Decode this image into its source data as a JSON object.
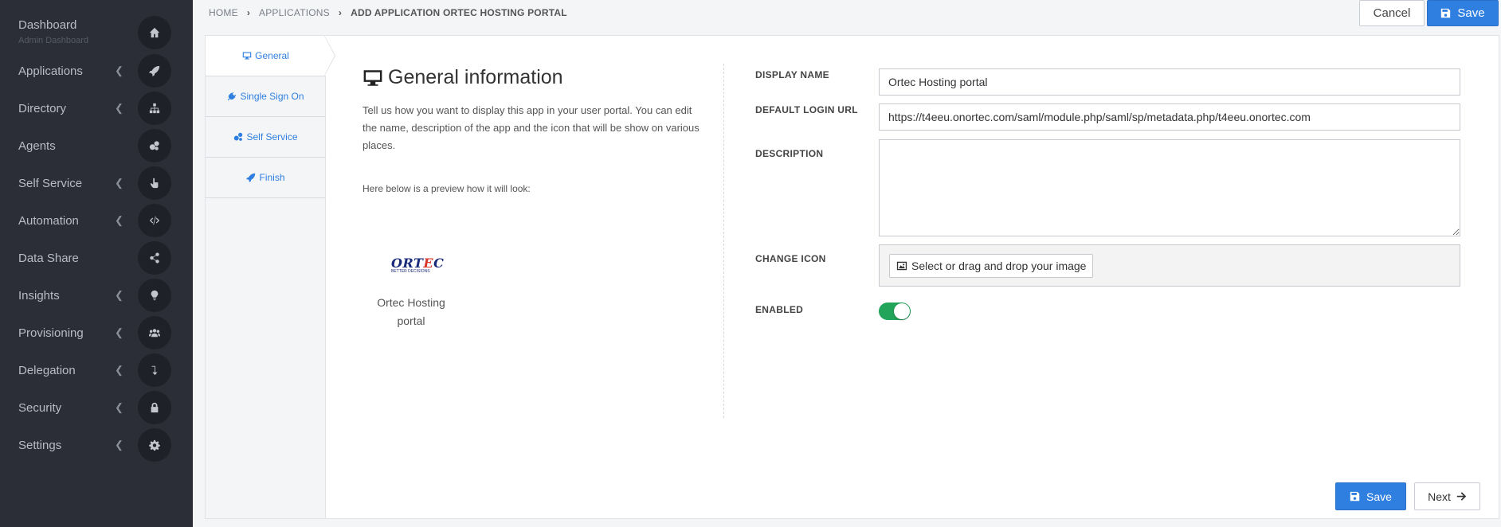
{
  "sidebar": {
    "items": [
      {
        "label": "Dashboard",
        "sublabel": "Admin Dashboard",
        "icon": "home-icon",
        "chevron": false
      },
      {
        "label": "Applications",
        "icon": "rocket-icon",
        "chevron": true
      },
      {
        "label": "Directory",
        "icon": "sitemap-icon",
        "chevron": true
      },
      {
        "label": "Agents",
        "icon": "cogs-icon",
        "chevron": false
      },
      {
        "label": "Self Service",
        "icon": "hand-pointer-icon",
        "chevron": true
      },
      {
        "label": "Automation",
        "icon": "code-icon",
        "chevron": true
      },
      {
        "label": "Data Share",
        "icon": "share-icon",
        "chevron": false
      },
      {
        "label": "Insights",
        "icon": "lightbulb-icon",
        "chevron": true
      },
      {
        "label": "Provisioning",
        "icon": "users-icon",
        "chevron": true
      },
      {
        "label": "Delegation",
        "icon": "level-down-icon",
        "chevron": true
      },
      {
        "label": "Security",
        "icon": "lock-icon",
        "chevron": true
      },
      {
        "label": "Settings",
        "icon": "gear-icon",
        "chevron": true
      }
    ]
  },
  "breadcrumb": {
    "home": "HOME",
    "applications": "APPLICATIONS",
    "current": "ADD APPLICATION ORTEC HOSTING PORTAL"
  },
  "toolbar": {
    "cancel_label": "Cancel",
    "save_label": "Save"
  },
  "tabs": [
    {
      "label": "General",
      "icon": "desktop-icon",
      "active": true
    },
    {
      "label": "Single Sign On",
      "icon": "plug-icon",
      "active": false
    },
    {
      "label": "Self Service",
      "icon": "cogs-icon",
      "active": false
    },
    {
      "label": "Finish",
      "icon": "rocket-icon",
      "active": false
    }
  ],
  "general": {
    "title": "General information",
    "description": "Tell us how you want to display this app in your user portal. You can edit the name, description of the app and the icon that will be show on various places.",
    "preview_label": "Here below is a preview how it will look:",
    "preview_logo": "ORTEC",
    "preview_logo_tagline": "BETTER DECISIONS",
    "preview_app_name": "Ortec Hosting portal"
  },
  "form": {
    "display_name_label": "DISPLAY NAME",
    "display_name_value": "Ortec Hosting portal",
    "login_url_label": "DEFAULT LOGIN URL",
    "login_url_value": "https://t4eeu.onortec.com/saml/module.php/saml/sp/metadata.php/t4eeu.onortec.com",
    "description_label": "DESCRIPTION",
    "description_value": "",
    "change_icon_label": "CHANGE ICON",
    "change_icon_button": "Select or drag and drop your image",
    "enabled_label": "ENABLED",
    "enabled": true
  },
  "footer": {
    "save_label": "Save",
    "next_label": "Next"
  },
  "colors": {
    "sidebar_bg": "#2b2e37",
    "accent": "#2f7fe0",
    "toggle_on": "#22a45a"
  }
}
